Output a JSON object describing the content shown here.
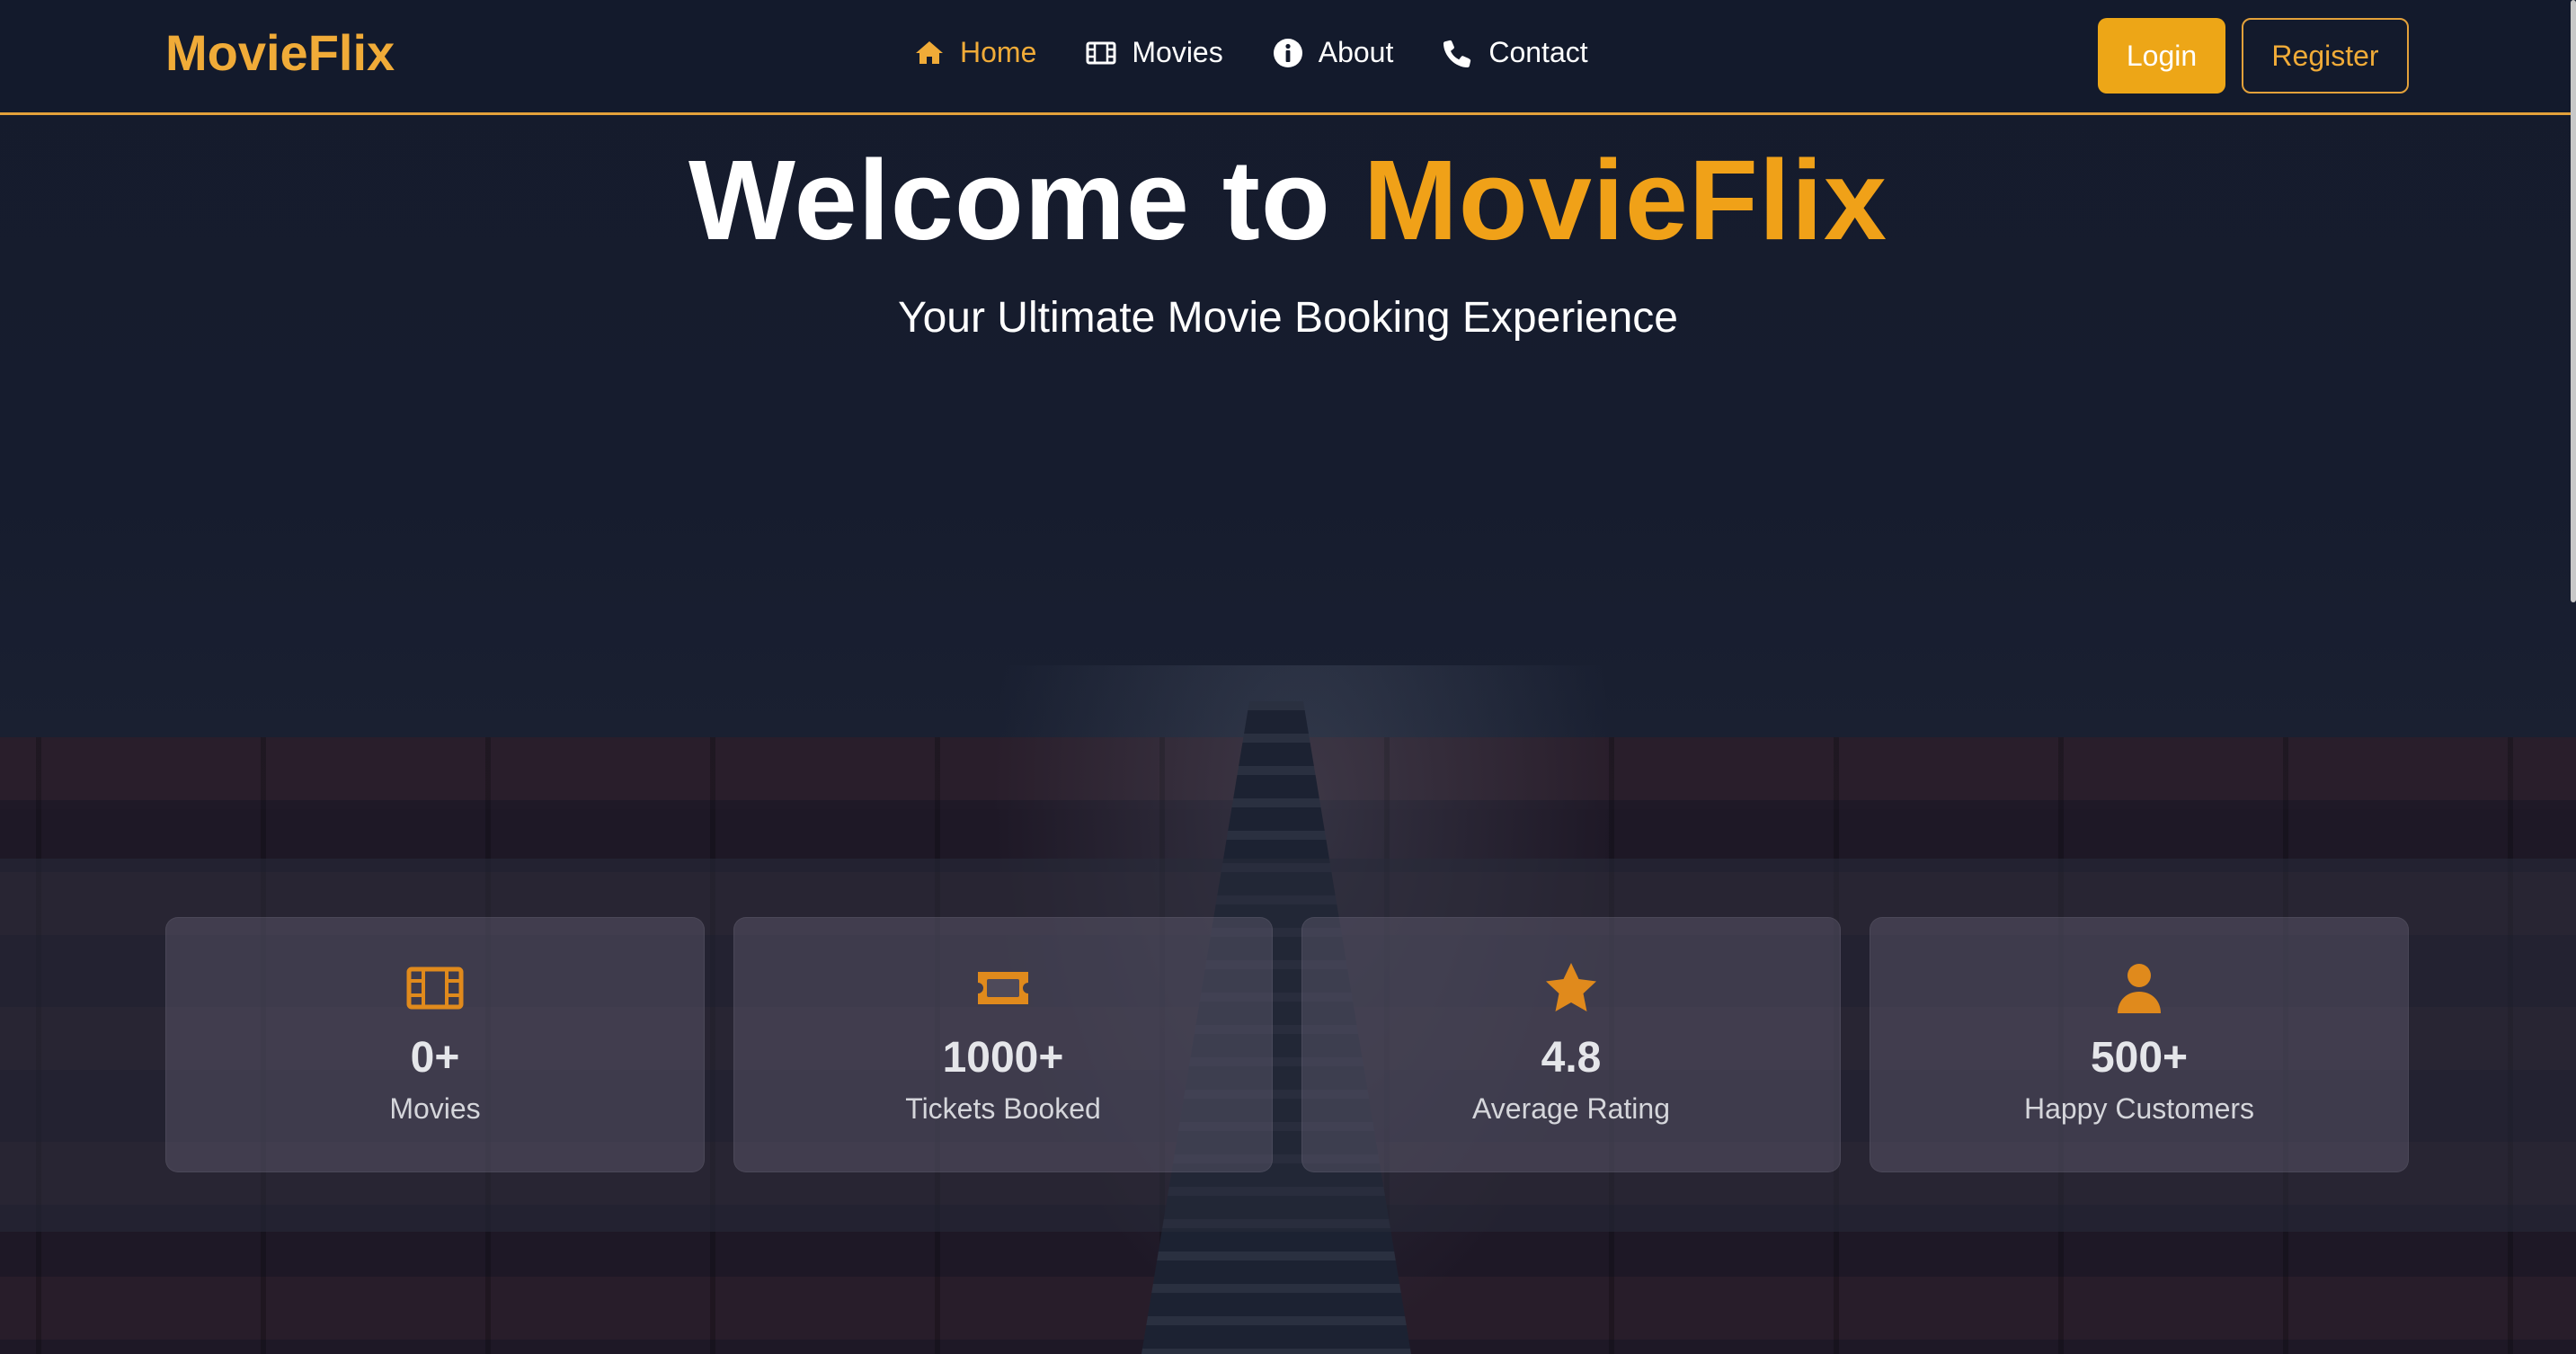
{
  "brand": {
    "logo": "MovieFlix",
    "accent_color": "#f0ab38"
  },
  "nav": {
    "items": [
      {
        "label": "Home",
        "icon": "home-icon",
        "active": true
      },
      {
        "label": "Movies",
        "icon": "film-icon",
        "active": false
      },
      {
        "label": "About",
        "icon": "info-icon",
        "active": false
      },
      {
        "label": "Contact",
        "icon": "phone-icon",
        "active": false
      }
    ]
  },
  "auth": {
    "login_label": "Login",
    "register_label": "Register"
  },
  "hero": {
    "title_prefix": "Welcome to",
    "title_accent": "MovieFlix",
    "subtitle": "Your Ultimate Movie Booking Experience"
  },
  "stats": [
    {
      "icon": "film-icon",
      "value": "0+",
      "label": "Movies"
    },
    {
      "icon": "ticket-icon",
      "value": "1000+",
      "label": "Tickets Booked"
    },
    {
      "icon": "star-icon",
      "value": "4.8",
      "label": "Average Rating"
    },
    {
      "icon": "user-icon",
      "value": "500+",
      "label": "Happy Customers"
    }
  ]
}
